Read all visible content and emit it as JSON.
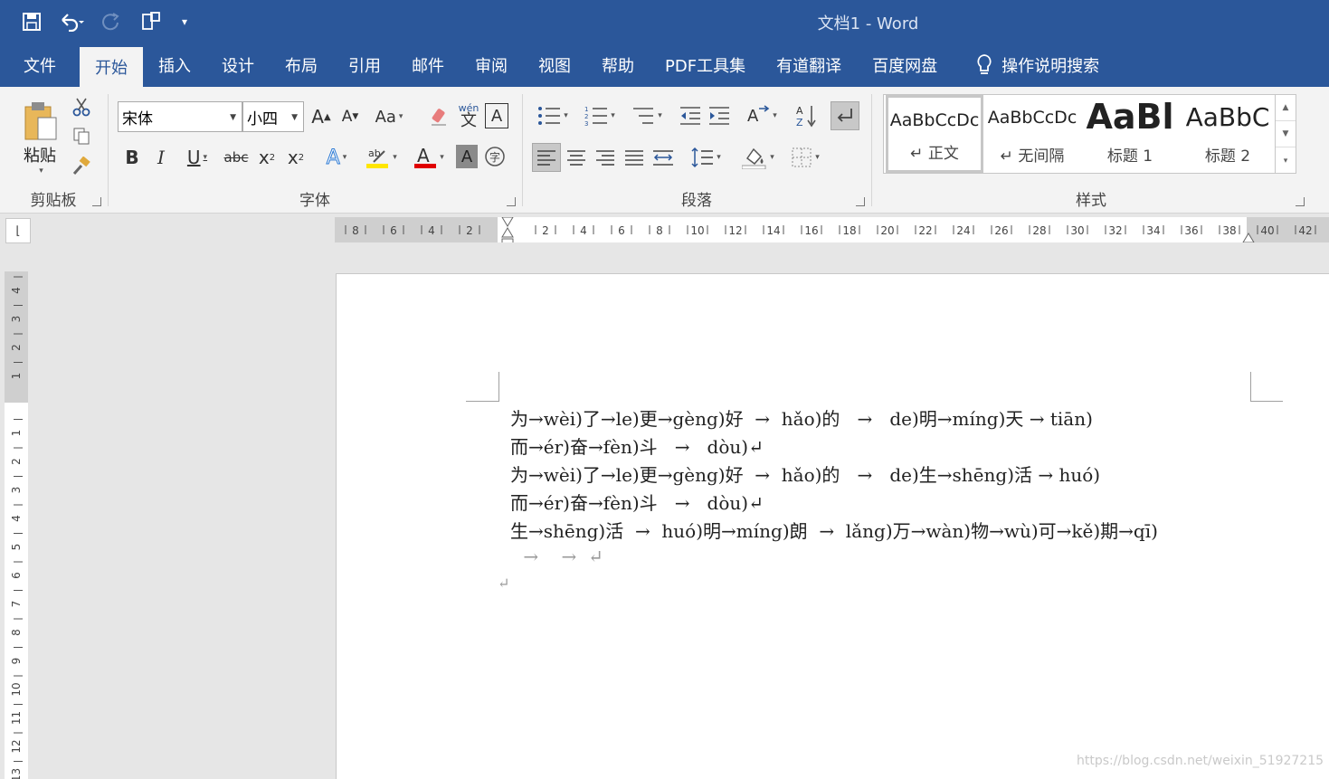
{
  "window": {
    "title": "文档1  -  Word"
  },
  "qat": {
    "save": "save-icon",
    "undo": "undo-icon",
    "redo": "redo-icon",
    "touch": "touch-mode-icon",
    "customize": "▾"
  },
  "tabs": [
    {
      "label": "文件"
    },
    {
      "label": "开始"
    },
    {
      "label": "插入"
    },
    {
      "label": "设计"
    },
    {
      "label": "布局"
    },
    {
      "label": "引用"
    },
    {
      "label": "邮件"
    },
    {
      "label": "审阅"
    },
    {
      "label": "视图"
    },
    {
      "label": "帮助"
    },
    {
      "label": "PDF工具集"
    },
    {
      "label": "有道翻译"
    },
    {
      "label": "百度网盘"
    }
  ],
  "tell_me": "操作说明搜索",
  "clipboard": {
    "paste_label": "粘贴",
    "group_label": "剪贴板"
  },
  "font": {
    "name": "宋体",
    "size": "小四",
    "group_label": "字体",
    "phonetic_top": "wén",
    "phonetic_char": "文"
  },
  "paragraph": {
    "group_label": "段落"
  },
  "styles": {
    "group_label": "样式",
    "items": [
      {
        "sample": "AaBbCcDc",
        "name": "↵ 正文"
      },
      {
        "sample": "AaBbCcDc",
        "name": "↵ 无间隔"
      },
      {
        "sample": "AaBl",
        "name": "标题 1"
      },
      {
        "sample": "AaBbC",
        "name": "标题 2"
      }
    ]
  },
  "ruler": {
    "h_left_labels": [
      "8",
      "6",
      "4",
      "2"
    ],
    "h_right_labels": [
      "2",
      "4",
      "6",
      "8",
      "10",
      "12",
      "14",
      "16",
      "18",
      "20",
      "22",
      "24",
      "26",
      "28",
      "30",
      "32",
      "34",
      "36",
      "38",
      "40",
      "42"
    ],
    "v_top_labels": [
      "4",
      "3",
      "2",
      "1"
    ],
    "v_labels": [
      "1",
      "2",
      "3",
      "4",
      "5",
      "6",
      "7",
      "8",
      "9",
      "10",
      "11",
      "12",
      "13"
    ]
  },
  "document": {
    "lines": [
      "为→wèi)了→le)更→gèng)好  →  hǎo)的   →   de)明→míng)天 → tiān)",
      "而→ér)奋→fèn)斗   →   dòu)↵",
      "为→wèi)了→le)更→gèng)好  →  hǎo)的   →   de)生→shēng)活 → huó)",
      "而→ér)奋→fèn)斗   →   dòu)↵",
      "生→shēng)活  →  huó)明→míng)朗  →  lǎng)万→wàn)物→wù)可→kě)期→qī)",
      " →    →  ↵",
      "↵"
    ]
  },
  "watermark": "https://blog.csdn.net/weixin_51927215"
}
